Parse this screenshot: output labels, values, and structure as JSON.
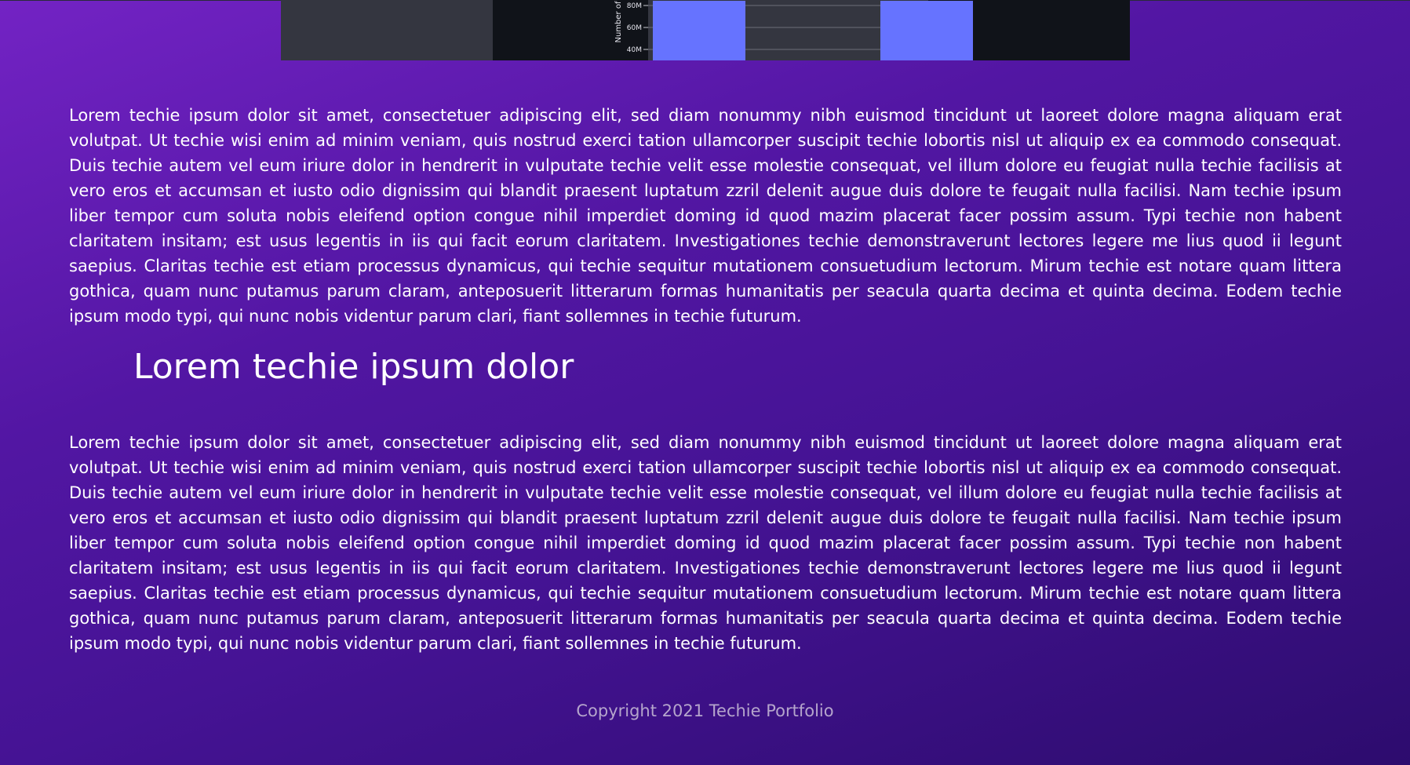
{
  "chart_data": {
    "type": "bar",
    "ylabel": "Number of",
    "y_ticks": [
      "80M",
      "60M",
      "40M"
    ],
    "y_tick_values": [
      80000000,
      60000000,
      40000000
    ],
    "bar_color": "#6673ff",
    "bars_visible": 2,
    "ylim_visible": [
      35000000,
      85000000
    ]
  },
  "content": {
    "paragraph_1": "Lorem techie ipsum dolor sit amet, consectetuer adipiscing elit, sed diam nonummy nibh euismod tincidunt ut laoreet dolore magna aliquam erat volutpat. Ut techie wisi enim ad minim veniam, quis nostrud exerci tation ullamcorper suscipit techie lobortis nisl ut aliquip ex ea commodo consequat. Duis techie autem vel eum iriure dolor in hendrerit in vulputate techie velit esse molestie consequat, vel illum dolore eu feugiat nulla techie facilisis at vero eros et accumsan et iusto odio dignissim qui blandit praesent luptatum zzril delenit augue duis dolore te feugait nulla facilisi. Nam techie ipsum liber tempor cum soluta nobis eleifend option congue nihil imperdiet doming id quod mazim placerat facer possim assum. Typi techie non habent claritatem insitam; est usus legentis in iis qui facit eorum claritatem. Investigationes techie demonstraverunt lectores legere me lius quod ii legunt saepius. Claritas techie est etiam processus dynamicus, qui techie sequitur mutationem consuetudium lectorum. Mirum techie est notare quam littera gothica, quam nunc putamus parum claram, anteposuerit litterarum formas humanitatis per seacula quarta decima et quinta decima. Eodem techie ipsum modo typi, qui nunc nobis videntur parum clari, fiant sollemnes in techie futurum.",
    "heading": "Lorem techie ipsum dolor",
    "paragraph_2": "Lorem techie ipsum dolor sit amet, consectetuer adipiscing elit, sed diam nonummy nibh euismod tincidunt ut laoreet dolore magna aliquam erat volutpat. Ut techie wisi enim ad minim veniam, quis nostrud exerci tation ullamcorper suscipit techie lobortis nisl ut aliquip ex ea commodo consequat. Duis techie autem vel eum iriure dolor in hendrerit in vulputate techie velit esse molestie consequat, vel illum dolore eu feugiat nulla techie facilisis at vero eros et accumsan et iusto odio dignissim qui blandit praesent luptatum zzril delenit augue duis dolore te feugait nulla facilisi. Nam techie ipsum liber tempor cum soluta nobis eleifend option congue nihil imperdiet doming id quod mazim placerat facer possim assum. Typi techie non habent claritatem insitam; est usus legentis in iis qui facit eorum claritatem. Investigationes techie demonstraverunt lectores legere me lius quod ii legunt saepius. Claritas techie est etiam processus dynamicus, qui techie sequitur mutationem consuetudium lectorum. Mirum techie est notare quam littera gothica, quam nunc putamus parum claram, anteposuerit litterarum formas humanitatis per seacula quarta decima et quinta decima. Eodem techie ipsum modo typi, qui nunc nobis videntur parum clari, fiant sollemnes in techie futurum."
  },
  "footer": {
    "copyright": "Copyright 2021 Techie Portfolio"
  },
  "theme": {
    "background_start": "#7323c4",
    "background_end": "#2d0c6e",
    "text_color": "#ffffff",
    "footer_text_color": "#b5a5cc"
  }
}
